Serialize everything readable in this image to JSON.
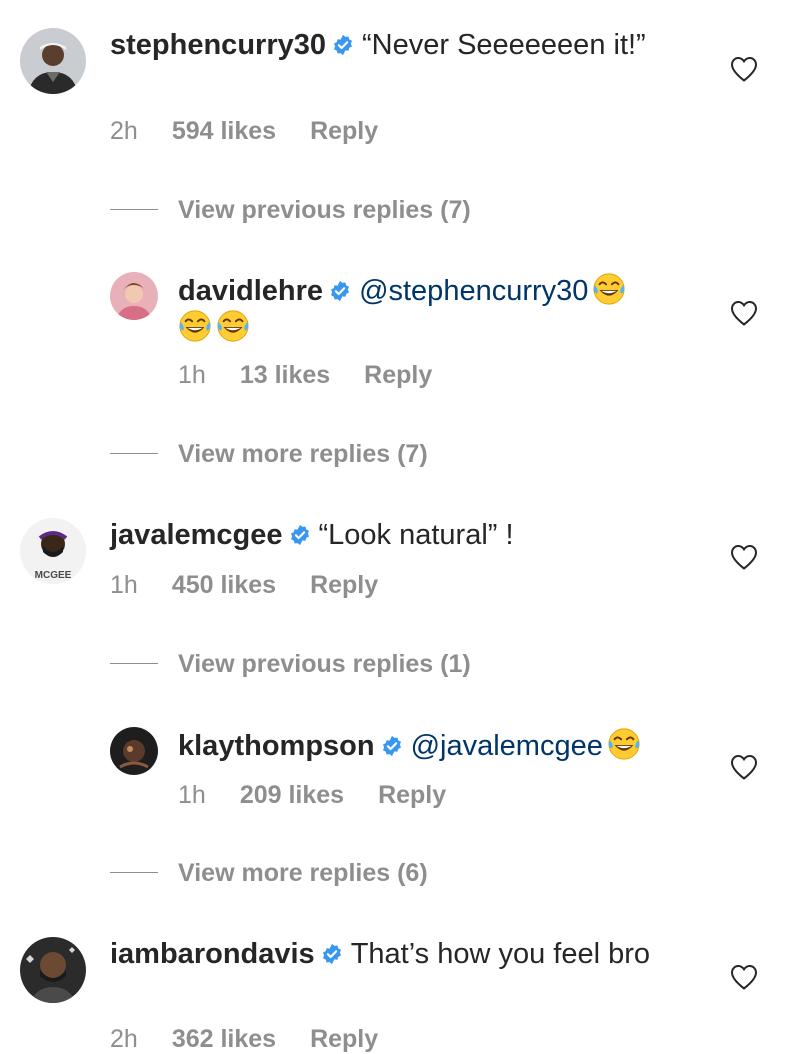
{
  "comments": [
    {
      "username": "stephencurry30",
      "text": "“Never Seeeeeeen it!”",
      "time": "2h",
      "likes": "594 likes",
      "reply": "Reply"
    },
    {
      "username": "davidlehre",
      "mention": "@stephencurry30",
      "emoji": [
        "face-with-tears-of-joy",
        "face-with-tears-of-joy",
        "face-with-tears-of-joy"
      ],
      "time": "1h",
      "likes": "13 likes",
      "reply": "Reply"
    },
    {
      "username": "javalemcgee",
      "text": "“Look natural” !",
      "avatar_text": "MCGEE",
      "time": "1h",
      "likes": "450 likes",
      "reply": "Reply"
    },
    {
      "username": "klaythompson",
      "mention": "@javalemcgee",
      "emoji": [
        "face-with-tears-of-joy"
      ],
      "time": "1h",
      "likes": "209 likes",
      "reply": "Reply"
    },
    {
      "username": "iambarondavis",
      "text": "That’s how you feel bro",
      "time": "2h",
      "likes": "362 likes",
      "reply": "Reply"
    }
  ],
  "threads": [
    {
      "label": "View previous replies (7)"
    },
    {
      "label": "View more replies (7)"
    },
    {
      "label": "View previous replies (1)"
    },
    {
      "label": "View more replies (6)"
    }
  ],
  "colors": {
    "text": "#262626",
    "muted": "#8e8e8e",
    "verified": "#3897f0",
    "mention": "#003569"
  },
  "icons": {
    "verified": "verified-badge-icon",
    "like": "heart-outline-icon"
  }
}
